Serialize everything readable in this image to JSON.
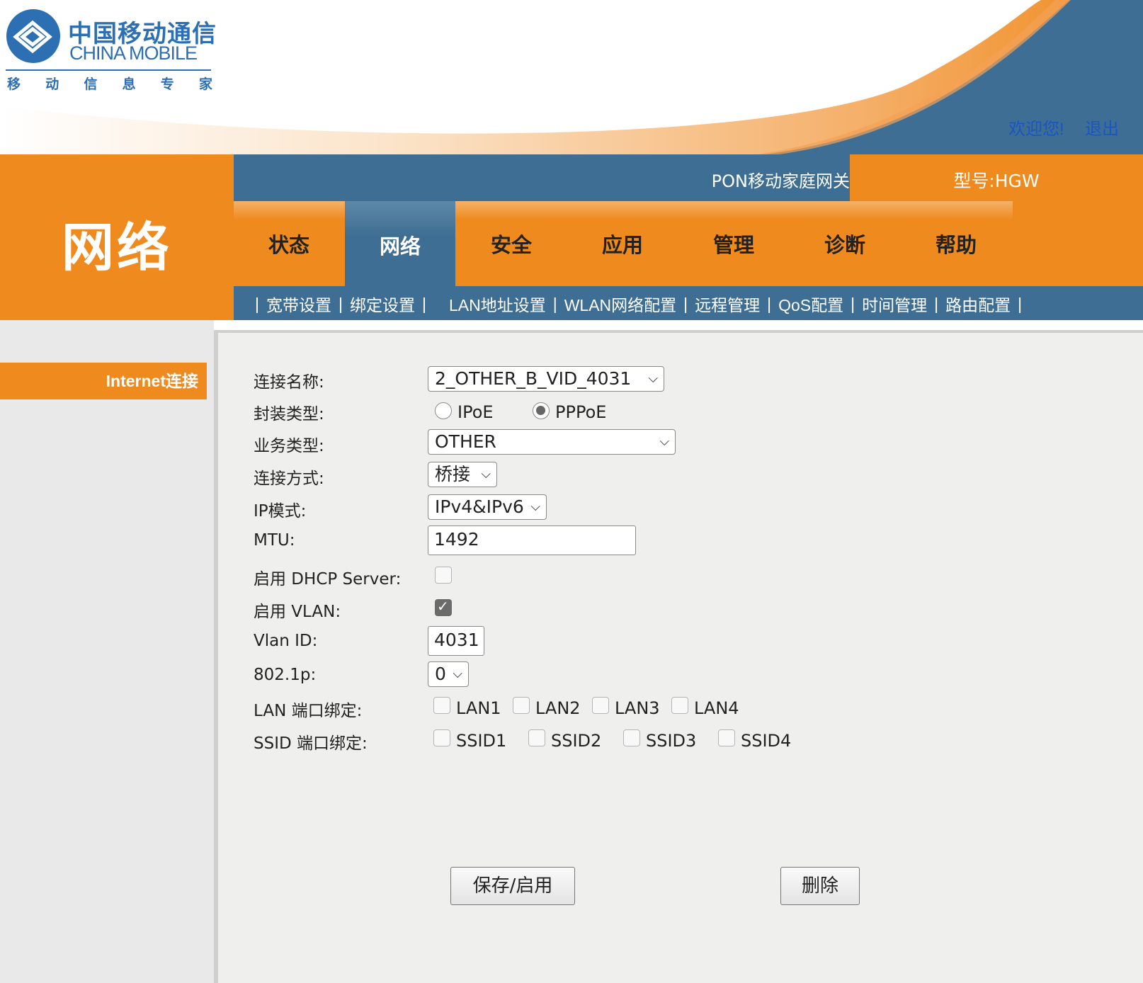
{
  "brand": {
    "cn": "中国移动通信",
    "en": "CHINA MOBILE",
    "slogan": [
      "移",
      "动",
      "信",
      "息",
      "专",
      "家"
    ]
  },
  "top_links": {
    "welcome": "欢迎您!",
    "logout": "退出"
  },
  "header": {
    "title": "PON移动家庭网关",
    "model": "型号:HGW"
  },
  "section_title": "网络",
  "tabs": [
    {
      "label": "状态"
    },
    {
      "label": "网络",
      "active": true
    },
    {
      "label": "安全"
    },
    {
      "label": "应用"
    },
    {
      "label": "管理"
    },
    {
      "label": "诊断"
    },
    {
      "label": "帮助"
    }
  ],
  "subnav": {
    "items": [
      "宽带设置",
      "绑定设置",
      "LAN地址设置",
      "WLAN网络配置",
      "远程管理",
      "QoS配置",
      "时间管理",
      "路由配置"
    ],
    "separator": "|"
  },
  "sidebar": {
    "active": "Internet连接"
  },
  "form": {
    "connection_name": {
      "label": "连接名称:",
      "value": "2_OTHER_B_VID_4031"
    },
    "encapsulation": {
      "label": "封装类型:",
      "options": [
        "IPoE",
        "PPPoE"
      ],
      "selected": "PPPoE"
    },
    "service_type": {
      "label": "业务类型:",
      "value": "OTHER"
    },
    "connection_mode": {
      "label": "连接方式:",
      "value": "桥接"
    },
    "ip_mode": {
      "label": "IP模式:",
      "value": "IPv4&IPv6"
    },
    "mtu": {
      "label": "MTU:",
      "value": "1492"
    },
    "dhcp_server": {
      "label": "启用 DHCP Server:",
      "checked": false
    },
    "vlan": {
      "label": "启用 VLAN:",
      "checked": true
    },
    "vlan_id": {
      "label": "Vlan ID:",
      "value": "4031"
    },
    "dot1p": {
      "label": "802.1p:",
      "value": "0"
    },
    "lan_binding": {
      "label": "LAN 端口绑定:",
      "ports": [
        "LAN1",
        "LAN2",
        "LAN3",
        "LAN4"
      ]
    },
    "ssid_binding": {
      "label": "SSID 端口绑定:",
      "ports": [
        "SSID1",
        "SSID2",
        "SSID3",
        "SSID4"
      ]
    }
  },
  "buttons": {
    "save": "保存/启用",
    "delete": "删除"
  },
  "colors": {
    "orange": "#ef8a1e",
    "steel_blue": "#3e6e93",
    "link_blue": "#1a55c7"
  }
}
